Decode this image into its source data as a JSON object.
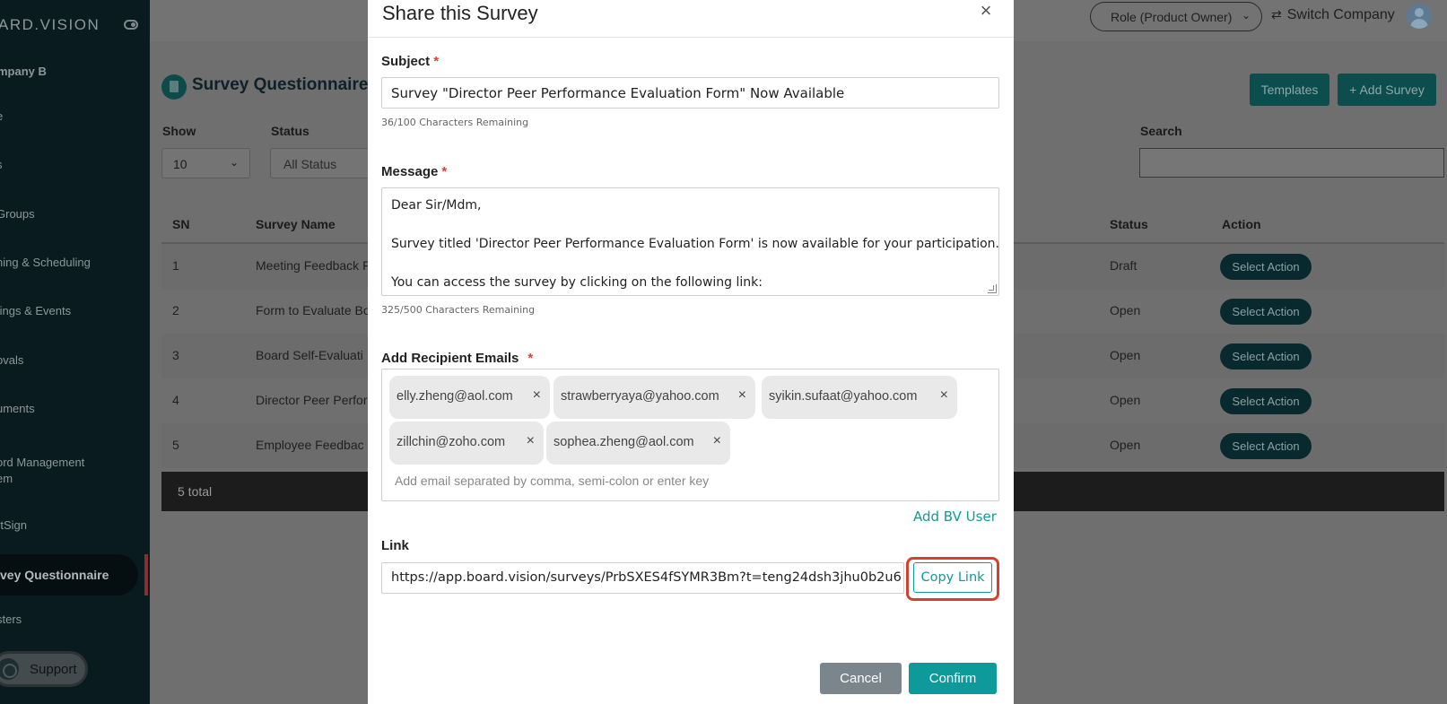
{
  "sidebar": {
    "brand": "ARD.VISION",
    "company": "mpany B",
    "items": [
      {
        "label": "e"
      },
      {
        "label": "s"
      },
      {
        "label": "Groups"
      },
      {
        "label": "ning & Scheduling"
      },
      {
        "label": "tings & Events"
      },
      {
        "label": "ovals"
      },
      {
        "label": "uments"
      },
      {
        "label": "ord Management"
      },
      {
        "label": "em"
      },
      {
        "label": "rtSign"
      },
      {
        "label": "vey Questionnaire"
      },
      {
        "label": "sters"
      }
    ],
    "support_label": "Support"
  },
  "topbar": {
    "role": "Role (Product Owner)",
    "switch_company": "Switch Company"
  },
  "page": {
    "title": "Survey Questionnaire",
    "templates_button": "Templates",
    "add_survey_button": "+ Add Survey",
    "filters": {
      "show_label": "Show",
      "show_value": "10",
      "status_label": "Status",
      "status_value": "All Status",
      "search_label": "Search"
    },
    "table": {
      "headers": {
        "sn": "SN",
        "name": "Survey Name",
        "status": "Status",
        "action": "Action"
      },
      "rows": [
        {
          "sn": "1",
          "name": "Meeting Feedback F",
          "status": "Draft",
          "action": "Select Action"
        },
        {
          "sn": "2",
          "name": "Form to Evaluate Bo",
          "status": "Open",
          "action": "Select Action"
        },
        {
          "sn": "3",
          "name": "Board Self-Evaluati",
          "status": "Open",
          "action": "Select Action"
        },
        {
          "sn": "4",
          "name": "Director Peer Perfor",
          "status": "Open",
          "action": "Select Action"
        },
        {
          "sn": "5",
          "name": "Employee Feedbac",
          "status": "Open",
          "action": "Select Action"
        }
      ],
      "footer": "5 total"
    }
  },
  "modal": {
    "title": "Share this Survey",
    "close": "×",
    "subject": {
      "label": "Subject",
      "required": "*",
      "value": "Survey \"Director Peer Performance Evaluation Form\" Now Available",
      "hint": "36/100 Characters Remaining"
    },
    "message": {
      "label": "Message",
      "required": "*",
      "lines": [
        "Dear Sir/Mdm,",
        "",
        "Survey titled 'Director Peer Performance Evaluation Form' is now available for your participation.",
        "",
        "You can access the survey by clicking on the following link:"
      ],
      "hint": "325/500 Characters Remaining"
    },
    "recipients": {
      "label": "Add Recipient Emails",
      "required": "*",
      "emails": [
        "elly.zheng@aol.com",
        "strawberryaya@yahoo.com",
        "syikin.sufaat@yahoo.com",
        "zillchin@zoho.com",
        "sophea.zheng@aol.com"
      ],
      "remove_glyph": "×",
      "placeholder": "Add email separated by comma, semi-colon or enter key",
      "add_bv_user": "Add BV User"
    },
    "link": {
      "label": "Link",
      "value": "https://app.board.vision/surveys/PrbSXES4fSYMR3Bm?t=teng24dsh3jhu0b2u6",
      "copy_button": "Copy Link"
    },
    "cancel_button": "Cancel",
    "confirm_button": "Confirm"
  },
  "colors": {
    "overlay": "#6f6f6f",
    "sidebar": "#0a1b20",
    "accent_teal": "#0e9a9a",
    "highlight_red": "#d6402e",
    "required_red": "#e03c3c"
  }
}
